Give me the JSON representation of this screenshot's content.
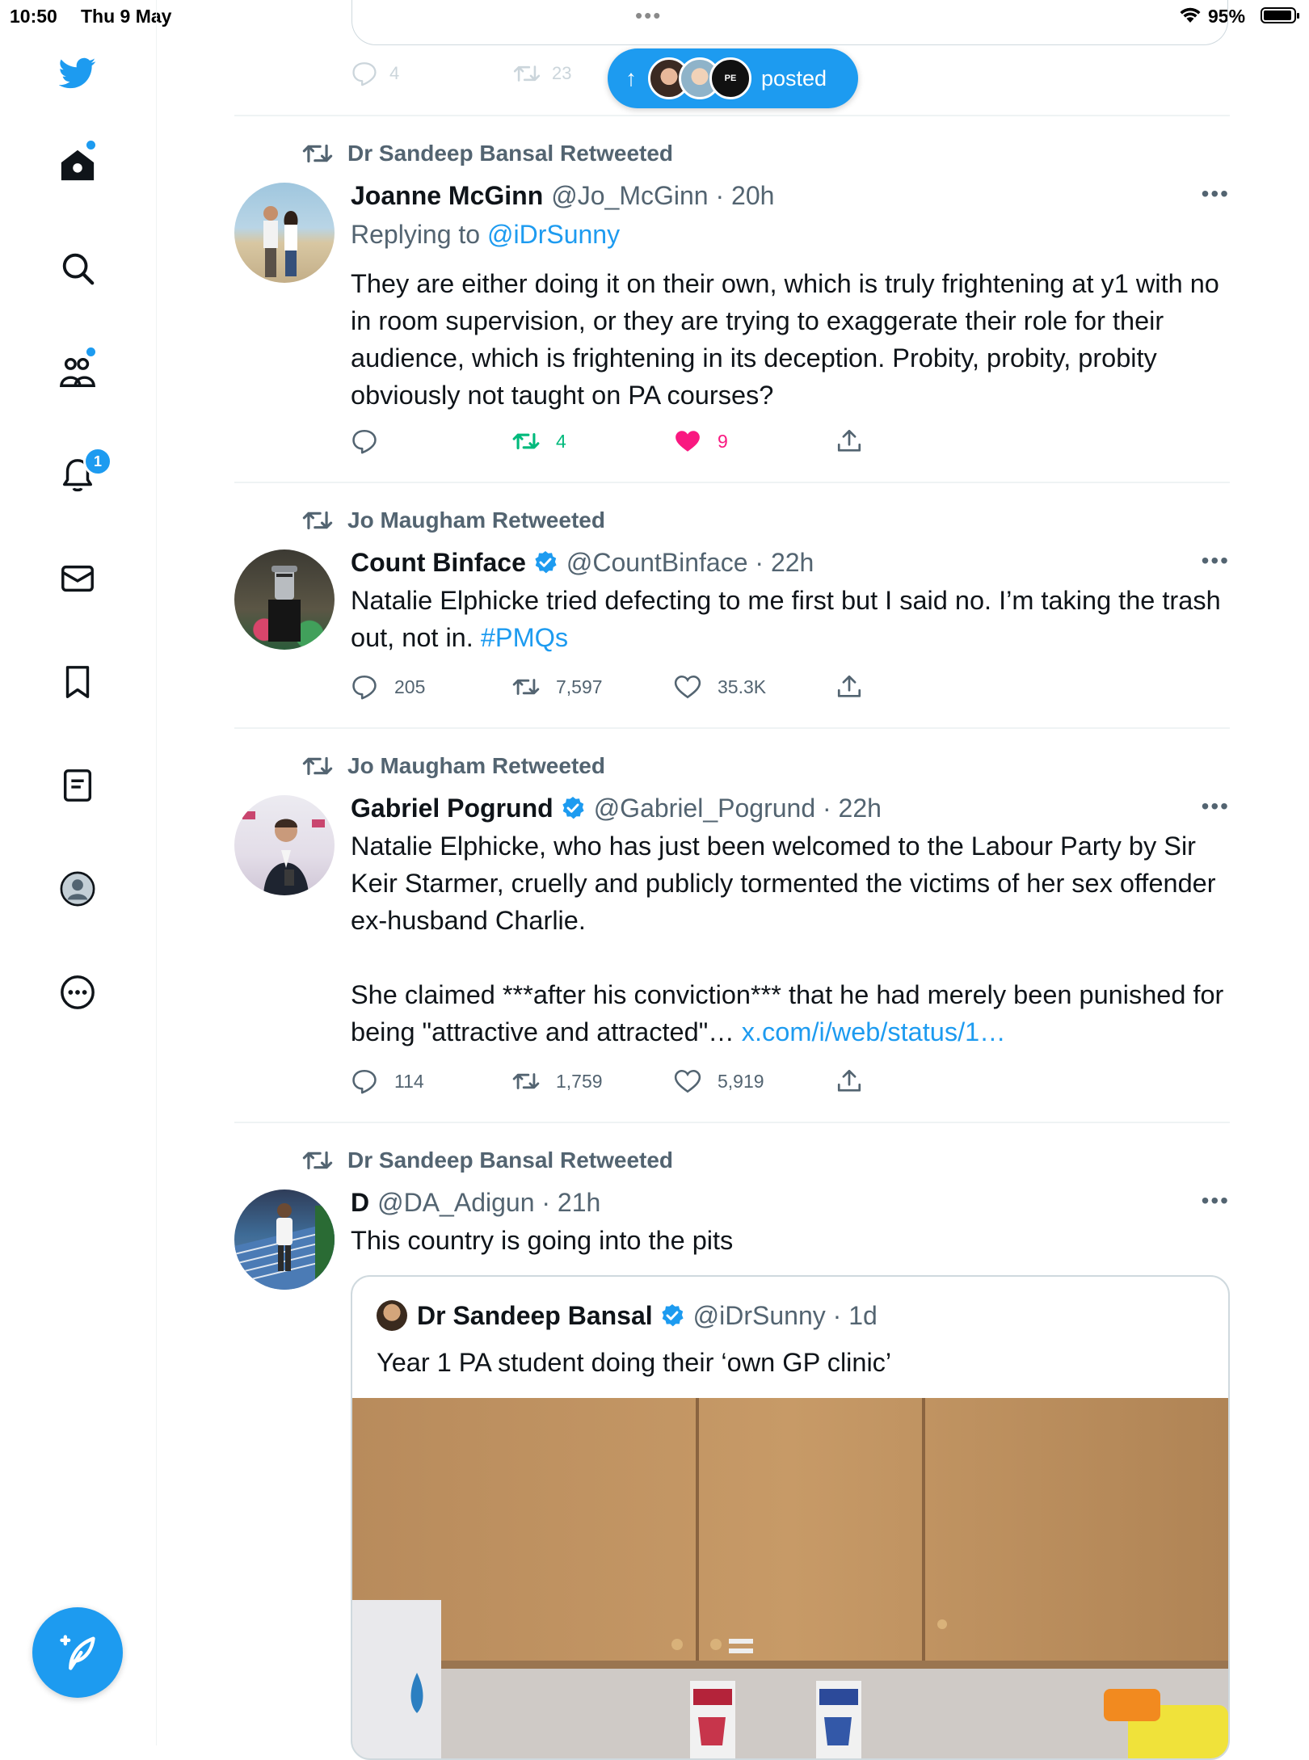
{
  "status_bar": {
    "time": "10:50",
    "date": "Thu 9 May",
    "battery": "95%"
  },
  "colors": {
    "accent": "#1d9bf0",
    "secondary_text": "#536471",
    "retweet_green": "#00ba7c",
    "like_pink": "#f91880"
  },
  "sidebar": {
    "items": [
      {
        "icon": "twitter-bird-icon"
      },
      {
        "icon": "home-icon",
        "has_dot": true
      },
      {
        "icon": "search-icon"
      },
      {
        "icon": "communities-icon",
        "has_dot": true
      },
      {
        "icon": "notifications-icon",
        "badge": "1"
      },
      {
        "icon": "messages-icon"
      },
      {
        "icon": "bookmarks-icon"
      },
      {
        "icon": "lists-icon"
      },
      {
        "icon": "profile-icon"
      },
      {
        "icon": "more-icon"
      }
    ],
    "compose_icon": "compose-tweet-icon"
  },
  "previous_tweet": {
    "replies": "4",
    "retweets": "23"
  },
  "new_posts_pill": {
    "label": "posted"
  },
  "tweets": [
    {
      "retweeted_by": "Dr Sandeep Bansal Retweeted",
      "name": "Joanne McGinn",
      "handle": "@Jo_McGinn · 20h",
      "verified": false,
      "replying_prefix": "Replying to",
      "replying_to": "@iDrSunny",
      "text": "They are either doing it on their own, which is truly frightening at y1 with no in room supervision, or they are trying to exaggerate their role for their audience, which is frightening in its deception. Probity, probity, probity obviously not taught on PA courses?",
      "replies": "",
      "retweets": "4",
      "likes": "9"
    },
    {
      "retweeted_by": "Jo Maugham Retweeted",
      "name": "Count Binface",
      "handle": "@CountBinface · 22h",
      "verified": true,
      "text": "Natalie Elphicke tried defecting to me first but I said no. I’m taking the trash out, not in. ",
      "hashtag": "#PMQs",
      "replies": "205",
      "retweets": "7,597",
      "likes": "35.3K"
    },
    {
      "retweeted_by": "Jo Maugham Retweeted",
      "name": "Gabriel Pogrund",
      "handle": "@Gabriel_Pogrund · 22h",
      "verified": true,
      "text": "Natalie Elphicke, who has just been welcomed to the Labour Party by Sir Keir Starmer, cruelly and publicly tormented the victims of her sex offender ex-husband Charlie.\n\nShe claimed ***after his conviction*** that he had merely been punished for being \"attractive and attracted\"… ",
      "link": "x.com/i/web/status/1…",
      "replies": "114",
      "retweets": "1,759",
      "likes": "5,919"
    },
    {
      "retweeted_by": "Dr Sandeep Bansal Retweeted",
      "name": "D",
      "handle": "@DA_Adigun · 21h",
      "verified": false,
      "text": "This country is going into the pits",
      "quote": {
        "name": "Dr Sandeep Bansal",
        "handle": "@iDrSunny · 1d",
        "verified": true,
        "text": "Year 1 PA student doing their ‘own GP clinic’"
      }
    }
  ]
}
